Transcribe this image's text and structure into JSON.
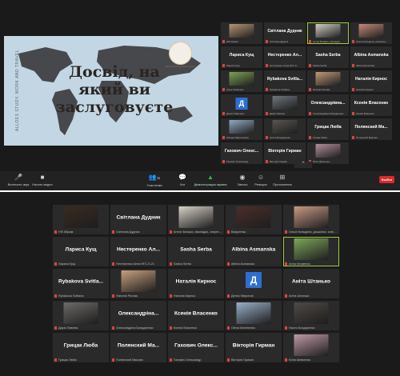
{
  "slide": {
    "title_lines": [
      "Досвід, на",
      "який ви",
      "заслуговуєте"
    ],
    "side_text": "ALLOES STUDY, WORK AND TRAVEL",
    "logo_text": "Alloes study work and travel"
  },
  "top_tiles": [
    {
      "name": "",
      "sub": "НФ Абрам",
      "video": "#b89576"
    },
    {
      "name": "Світлана Дудник",
      "sub": "Світлана Дудник"
    },
    {
      "name": "",
      "sub": "Антон Блажко, викладач",
      "video": "#d4cfc4",
      "active": true
    },
    {
      "name": "",
      "sub": "Ольга Кольдюга, дошкільн...",
      "video": "#c58a7a"
    },
    {
      "name": "Лариса Кущ",
      "sub": "Лариса Кущ"
    },
    {
      "name": "Нестеренко Ал...",
      "sub": "Нестеренко Анна НГС-9..."
    },
    {
      "name": "Sasha Serba",
      "sub": "Sasha Serba"
    },
    {
      "name": "Albina Asmanska",
      "sub": "Albina Asmanska"
    },
    {
      "name": "",
      "sub": "Анна Клименко",
      "video": "#7da255"
    },
    {
      "name": "Rybakova Svitla...",
      "sub": "Rybakova Svitlana"
    },
    {
      "name": "",
      "sub": "Наталія Рогова",
      "video": "#bf9a78"
    },
    {
      "name": "Наталія Кирнос",
      "sub": "Наталія Кирнос"
    },
    {
      "name": "Д",
      "sub": "Денис Миронов",
      "avatar": true
    },
    {
      "name": "",
      "sub": "Дарія Павлюк",
      "video": "#6f7780"
    },
    {
      "name": "Олександрівна...",
      "sub": "Олександрівна Бондаренко"
    },
    {
      "name": "Ксенія Власенко",
      "sub": "Ксенія Власенко"
    },
    {
      "name": "",
      "sub": "Оксана Мартиненко",
      "video": "#8faac2"
    },
    {
      "name": "",
      "sub": "Настя Бондаренко",
      "video": "#5a5550"
    },
    {
      "name": "Грицак Люба",
      "sub": "Грицак Люба"
    },
    {
      "name": "Полянский Ма...",
      "sub": "Полянский Максим"
    },
    {
      "name": "Гахович Олекс...",
      "sub": "Гахович Олександр"
    },
    {
      "name": "Вікторія Гирман",
      "sub": "Вікторія Гирман"
    },
    {
      "name": "",
      "sub": "Юлія Шевченко",
      "video": "#b38f9a"
    }
  ],
  "toolbar": {
    "items": [
      {
        "label": "Включить звук",
        "icon": "microphone-icon"
      },
      {
        "label": "Начать видео",
        "icon": "video-camera-icon"
      },
      {
        "label": "Участники",
        "icon": "participants-icon",
        "count": "35"
      },
      {
        "label": "Чат",
        "icon": "chat-icon"
      },
      {
        "label": "Демонстрация экрана",
        "icon": "share-screen-icon"
      },
      {
        "label": "Запись",
        "icon": "record-icon"
      },
      {
        "label": "Реакции",
        "icon": "reactions-icon"
      },
      {
        "label": "Приложения",
        "icon": "apps-icon"
      }
    ],
    "end_label": "Выйти"
  },
  "bottom_tiles": [
    {
      "name": "",
      "sub": "НФ Абрам",
      "video": "#3a2a20"
    },
    {
      "name": "Світлана Дудник",
      "sub": "Світлана Дудник"
    },
    {
      "name": "",
      "sub": "Антон Блажко, викладач, секретар",
      "video": "#d7d1c6"
    },
    {
      "name": "",
      "sub": "Вакуленко",
      "video": "#4a2e2a"
    },
    {
      "name": "",
      "sub": "Ольга Кольдюга, дошкільн. освіта...",
      "video": "#c99a84"
    },
    {
      "name": "Лариса Кущ",
      "sub": "Лариса Кущ"
    },
    {
      "name": "Нестеренко Ал...",
      "sub": "Нестеренко Анна НГС-9-21"
    },
    {
      "name": "Sasha Serba",
      "sub": "Sasha Serba"
    },
    {
      "name": "Albina Asmanska",
      "sub": "Albina Asmanska"
    },
    {
      "name": "",
      "sub": "Анна Клименко",
      "video": "#7ea65a",
      "active": true
    },
    {
      "name": "Rybakova Svitla...",
      "sub": "Rybakova Svitlana"
    },
    {
      "name": "",
      "sub": "Наталія Рогова",
      "video": "#c7a07e"
    },
    {
      "name": "Наталія Кирнос",
      "sub": "Наталія Кирнос"
    },
    {
      "name": "Д",
      "sub": "Денис Миронов",
      "avatar": true
    },
    {
      "name": "Аніта Штанько",
      "sub": "Аніта Штанько"
    },
    {
      "name": "",
      "sub": "Дарія Павлюк",
      "video": "#6d6a68"
    },
    {
      "name": "Олександріна...",
      "sub": "Олександріна Бондаренко"
    },
    {
      "name": "Ксенія Власенко",
      "sub": "Ксенія Власенко"
    },
    {
      "name": "",
      "sub": "Olena Martinenko",
      "video": "#98b0c8"
    },
    {
      "name": "",
      "sub": "Настя Бондаренко",
      "video": "#4e4a46"
    },
    {
      "name": "Грицак Люба",
      "sub": "Грицак Люба"
    },
    {
      "name": "Полянский Ма...",
      "sub": "Полянский Максим"
    },
    {
      "name": "Гахович Олекс...",
      "sub": "Гахович Олександр"
    },
    {
      "name": "Вікторія Гирман",
      "sub": "Вікторія Гирман"
    },
    {
      "name": "",
      "sub": "Юлія Шевченко",
      "video": "#bf9aa6"
    }
  ]
}
